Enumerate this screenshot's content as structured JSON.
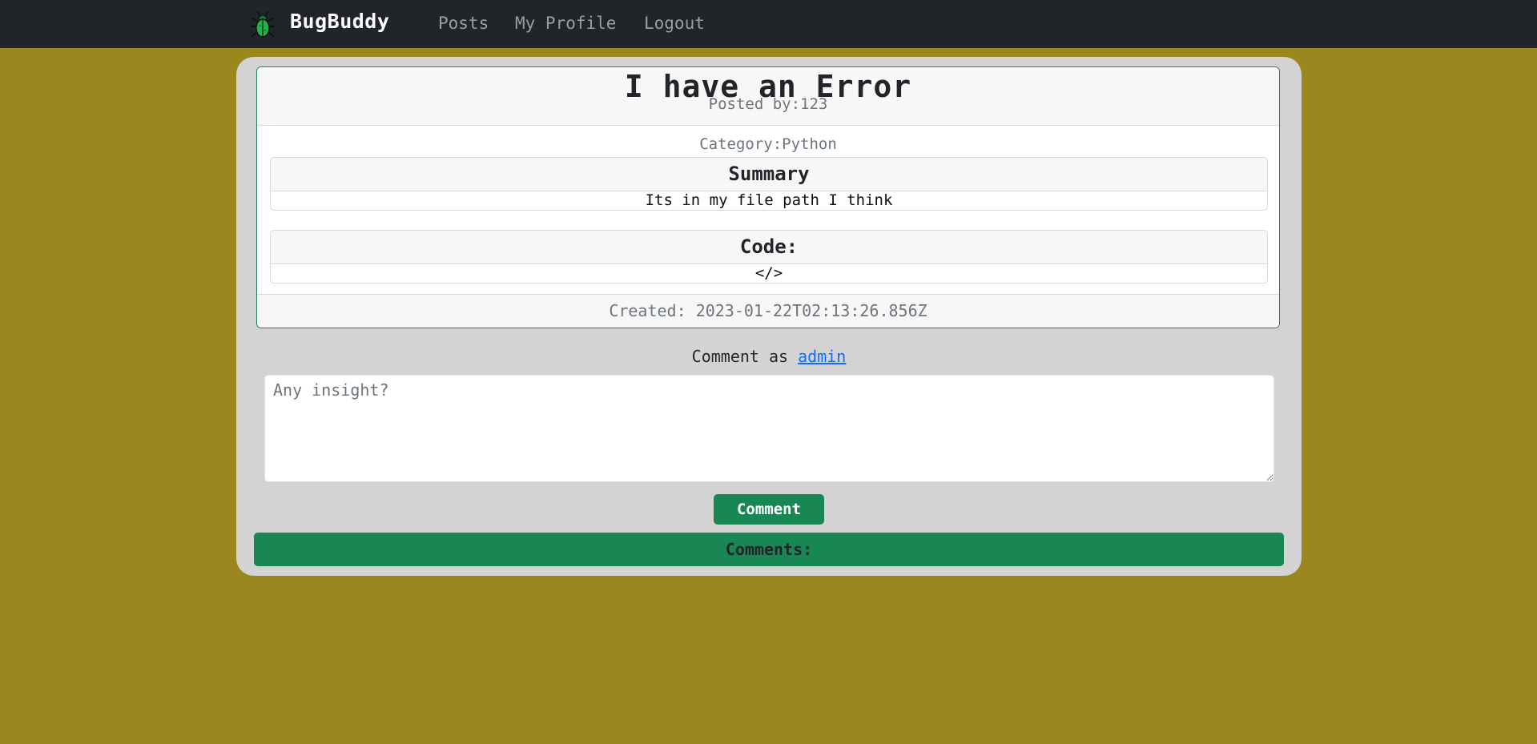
{
  "nav": {
    "brand": "BugBuddy",
    "logo_icon": "bug-icon",
    "links": [
      "Posts",
      "My Profile",
      "Logout"
    ]
  },
  "post": {
    "title": "I have an Error",
    "author_label": "Posted by:",
    "author": "123",
    "category_label": "Category:",
    "category": "Python",
    "summary_heading": "Summary",
    "summary": "Its in my file path I think",
    "code_heading": "Code:",
    "code": "</>",
    "created_label": "Created:",
    "created": "2023-01-22T02:13:26.856Z"
  },
  "comment_form": {
    "label": "Comment as",
    "user": "admin",
    "placeholder": "Any insight?",
    "value": "",
    "submit_label": "Comment"
  },
  "comments": {
    "heading": "Comments:",
    "items": []
  },
  "colors": {
    "page_background": "#9c871e",
    "navbar": "#212529",
    "panel": "#d3d3d3",
    "accent_green": "#198754",
    "link_blue": "#0d6efd"
  }
}
